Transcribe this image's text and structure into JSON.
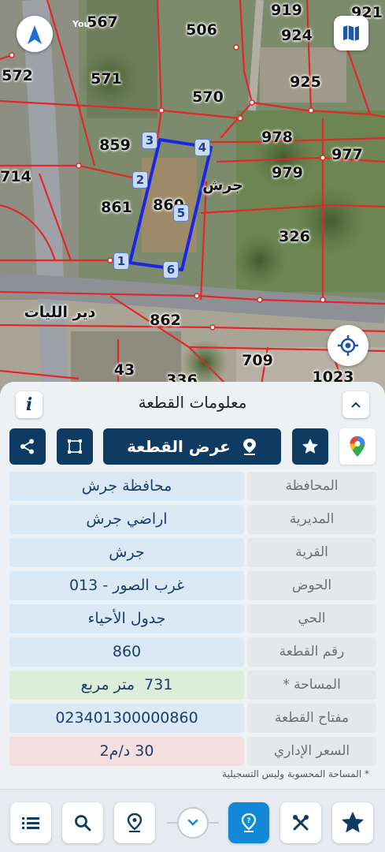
{
  "map": {
    "plot_numbers": [
      "567",
      "506",
      "919",
      "921",
      "924",
      "572",
      "571",
      "570",
      "925",
      "859",
      "978",
      "977",
      "714",
      "979",
      "861",
      "860",
      "326",
      "862",
      "709",
      "43",
      "336",
      "1023"
    ],
    "place_names": [
      "جرش",
      "دير الليات"
    ],
    "vertex_numbers": [
      "1",
      "2",
      "3",
      "4",
      "5",
      "6"
    ],
    "compass_letter": "N",
    "provider_mark": "You",
    "colors": {
      "boundary": "#e3262a",
      "selected_plot": "#1a25e6"
    }
  },
  "panel": {
    "title": "معلومات القطعة",
    "show_plot_label": "عرض القطعة",
    "rows": [
      {
        "label": "المحافظة",
        "value": "محافظة جرش",
        "tint": "blue"
      },
      {
        "label": "المديرية",
        "value": "اراضي جرش",
        "tint": "blue"
      },
      {
        "label": "القرية",
        "value": "جرش",
        "tint": "blue"
      },
      {
        "label": "الحوض",
        "value": "غرب الصور - 013",
        "tint": "blue"
      },
      {
        "label": "الحي",
        "value": "جدول الأحياء",
        "tint": "blue"
      },
      {
        "label": "رقم القطعة",
        "value": "860",
        "tint": "blue"
      },
      {
        "label": "المساحة *",
        "value": "731  متر مربع",
        "tint": "green"
      },
      {
        "label": "مفتاح القطعة",
        "value": "023401300000860",
        "tint": "blue"
      },
      {
        "label": "السعر الإداري",
        "value": "30 د/م2",
        "tint": "red"
      }
    ],
    "footnote": "* المساحة المحسوبة وليس التسجيلية",
    "colors": {
      "primary": "#0f3b63",
      "active": "#1189d6"
    }
  }
}
